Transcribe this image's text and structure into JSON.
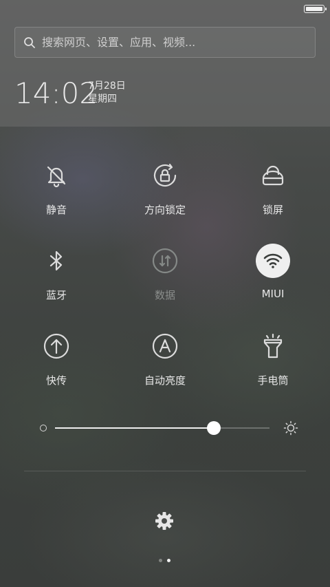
{
  "search": {
    "placeholder": "搜索网页、设置、应用、视频..."
  },
  "clock": {
    "time": "14:02",
    "date": "7月28日",
    "weekday": "星期四"
  },
  "tiles": [
    {
      "label": "静音",
      "icon": "bell-off-icon"
    },
    {
      "label": "方向锁定",
      "icon": "rotation-lock-icon"
    },
    {
      "label": "锁屏",
      "icon": "lock-icon"
    },
    {
      "label": "蓝牙",
      "icon": "bluetooth-icon"
    },
    {
      "label": "数据",
      "icon": "mobile-data-icon",
      "state": "disabled"
    },
    {
      "label": "MIUI",
      "icon": "wifi-icon",
      "state": "active"
    },
    {
      "label": "快传",
      "icon": "upload-arrow-icon"
    },
    {
      "label": "自动亮度",
      "icon": "auto-brightness-icon"
    },
    {
      "label": "手电筒",
      "icon": "flashlight-icon"
    }
  ],
  "brightness": {
    "level_percent": 74
  },
  "pager": {
    "pages": 2,
    "current": 2
  },
  "colors": {
    "active_tile_bg": "#efefef",
    "accent": "#ffffff"
  }
}
